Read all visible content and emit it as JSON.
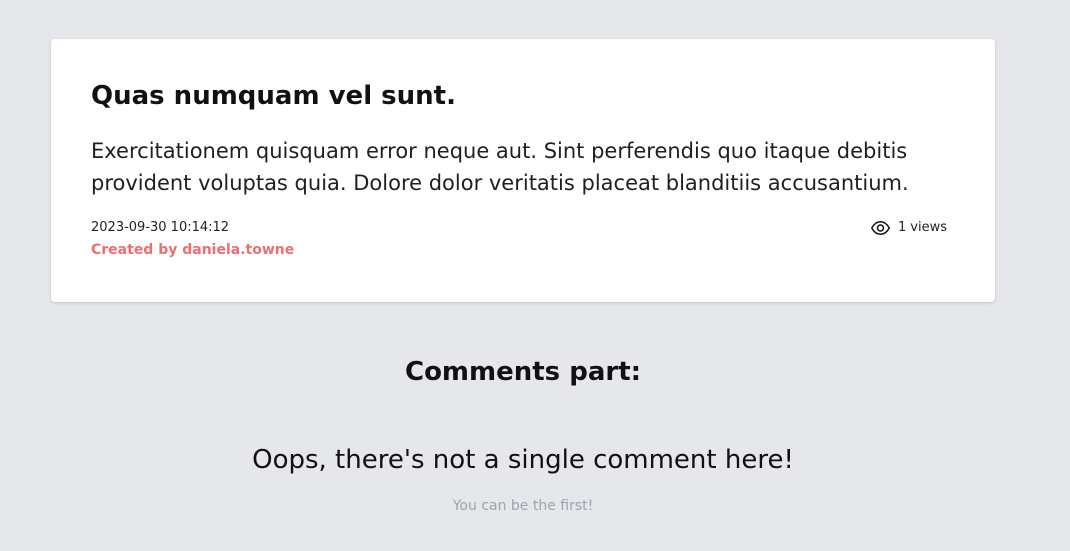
{
  "post": {
    "title": "Quas numquam vel sunt.",
    "body": "Exercitationem quisquam error neque aut. Sint perferendis quo itaque debitis provident voluptas quia. Dolore dolor veritatis placeat blanditiis accusantium.",
    "date": "2023-09-30 10:14:12",
    "author_label": "Created by daniela.towne",
    "views_count": "1",
    "views_label": "views",
    "views_icon": "eye-icon"
  },
  "comments": {
    "heading": "Comments part:",
    "empty_title": "Oops, there's not a single comment here!",
    "empty_subtitle": "You can be the first!"
  },
  "colors": {
    "page_background": "#e5e7eb",
    "card_background": "#ffffff",
    "author_accent": "#ef6f6f",
    "muted_text": "#9ca3af"
  }
}
